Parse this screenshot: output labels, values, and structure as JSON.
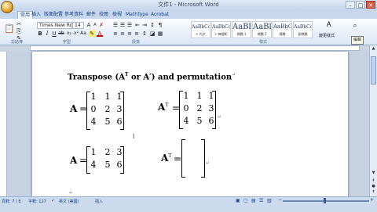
{
  "window": {
    "title": "文件1 - Microsoft Word"
  },
  "tabs": [
    "常用",
    "插入",
    "版面配置",
    "參考資料",
    "郵件",
    "校閱",
    "檢視",
    "MathType",
    "Acrobat"
  ],
  "font": {
    "name": "Times New Roma",
    "size": "14"
  },
  "groups": [
    "剪貼簿",
    "字型",
    "段落",
    "樣式"
  ],
  "styles": [
    {
      "sample": "AaBbCcD",
      "name": "+ 內文"
    },
    {
      "sample": "AaBbCcD",
      "name": "+ 無間距"
    },
    {
      "sample": "AaBl",
      "name": "標題 1"
    },
    {
      "sample": "AaBl",
      "name": "標題 2"
    },
    {
      "sample": "AaBbC",
      "name": "標題"
    },
    {
      "sample": "AaBbCcD",
      "name": "副標題"
    }
  ],
  "change_styles": "變更樣式",
  "edit_label": "編輯",
  "doc": {
    "heading": "Transpose (A",
    "heading_T": "T",
    "heading_or": "  or  A′) and permutation",
    "A": "A",
    "T": "T",
    "eq": "=",
    "matrix1": [
      [
        "1",
        "1",
        "1"
      ],
      [
        "0",
        "2",
        "3"
      ],
      [
        "4",
        "5",
        "6"
      ]
    ],
    "matrix2": [
      [
        "1",
        "1",
        "1"
      ],
      [
        "0",
        "2",
        "3"
      ],
      [
        "4",
        "5",
        "6"
      ]
    ],
    "matrix3": [
      [
        "1",
        "2",
        "3"
      ],
      [
        "4",
        "5",
        "6"
      ]
    ]
  },
  "status": {
    "page": "頁數: 7 / 8",
    "words": "字數: 127",
    "lang": "英文 (美國)",
    "mode": "插入"
  }
}
